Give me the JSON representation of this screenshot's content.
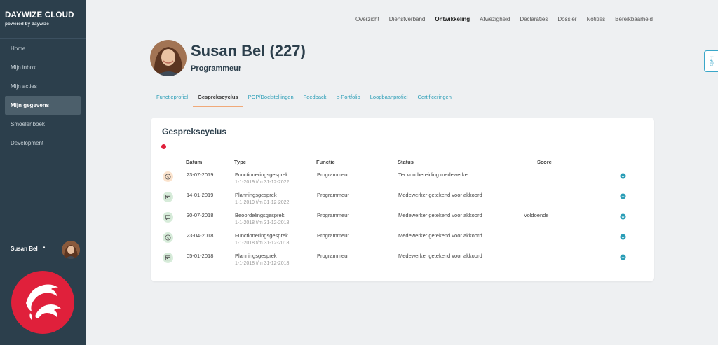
{
  "brand": {
    "title": "DAYWIZE CLOUD",
    "subtitle": "powered by daywize"
  },
  "sidebar": {
    "items": [
      {
        "label": "Home"
      },
      {
        "label": "Mijn inbox"
      },
      {
        "label": "Mijn acties"
      },
      {
        "label": "Mijn gegevens"
      },
      {
        "label": "Smoelenboek"
      },
      {
        "label": "Development"
      }
    ],
    "active_index": 3,
    "user_name": "Susan Bel",
    "user_caret": "▲"
  },
  "topnav": {
    "items": [
      "Overzicht",
      "Dienstverband",
      "Ontwikkeling",
      "Afwezigheid",
      "Declaraties",
      "Dossier",
      "Notities",
      "Bereikbaarheid"
    ],
    "active_index": 2
  },
  "help": {
    "label": "Help"
  },
  "profile": {
    "name": "Susan Bel (227)",
    "role": "Programmeur"
  },
  "subtabs": {
    "items": [
      "Functieprofiel",
      "Gesprekscyclus",
      "POP/Doelstellingen",
      "Feedback",
      "e-Portfolio",
      "Loopbaanprofiel",
      "Certificeringen"
    ],
    "active_index": 1
  },
  "card": {
    "title": "Gesprekscyclus",
    "columns": {
      "datum": "Datum",
      "type": "Type",
      "functie": "Functie",
      "status": "Status",
      "score": "Score"
    },
    "rows": [
      {
        "icon": "dollar-icon",
        "icon_color": "orange",
        "datum": "23-07-2019",
        "type": "Functioneringsgesprek",
        "period": "1-1-2019 t/m 31-12-2022",
        "functie": "Programmeur",
        "status": "Ter voorbereiding medewerker",
        "score": ""
      },
      {
        "icon": "calendar-icon",
        "icon_color": "green",
        "datum": "14-01-2019",
        "type": "Planningsgesprek",
        "period": "1-1-2019 t/m 31-12-2022",
        "functie": "Programmeur",
        "status": "Medewerker getekend voor akkoord",
        "score": ""
      },
      {
        "icon": "comment-icon",
        "icon_color": "green",
        "datum": "30-07-2018",
        "type": "Beoordelingsgesprek",
        "period": "1-1-2018 t/m 31-12-2018",
        "functie": "Programmeur",
        "status": "Medewerker getekend voor akkoord",
        "score": "Voldoende"
      },
      {
        "icon": "dollar-icon",
        "icon_color": "green",
        "datum": "23-04-2018",
        "type": "Functioneringsgesprek",
        "period": "1-1-2018 t/m 31-12-2018",
        "functie": "Programmeur",
        "status": "Medewerker getekend voor akkoord",
        "score": ""
      },
      {
        "icon": "calendar-icon",
        "icon_color": "green",
        "datum": "05-01-2018",
        "type": "Planningsgesprek",
        "period": "1-1-2018 t/m 31-12-2018",
        "functie": "Programmeur",
        "status": "Medewerker getekend voor akkoord",
        "score": ""
      }
    ]
  },
  "colors": {
    "sidebar": "#2c3f4c",
    "accent": "#2a9db6",
    "brand_red": "#e0203b",
    "tab_underline": "#f0a979"
  }
}
